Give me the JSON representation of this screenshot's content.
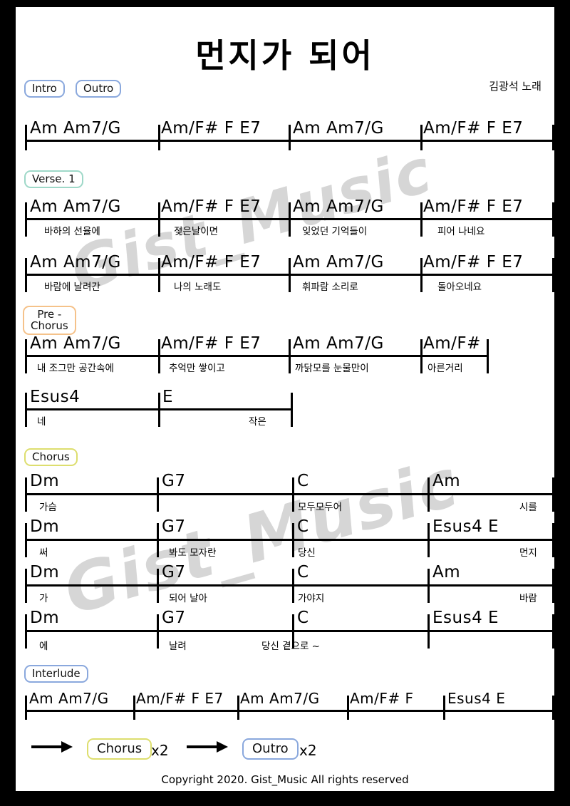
{
  "document": {
    "title": "먼지가 되어",
    "artist_credit": "김광석 노래",
    "copyright": "Copyright 2020. Gist_Music All rights reserved",
    "watermark": "Gist_Music"
  },
  "colors": {
    "page_background": "#ffffff",
    "frame": "#000000",
    "chip_blue": "#8aa8dd",
    "chip_teal": "#9ed8c8",
    "chip_orange": "#f5c28a",
    "chip_yellow": "#ddde6e",
    "watermark": "#d6d6d6",
    "ink": "#000000"
  },
  "sections": [
    {
      "id": "intro-outro",
      "labels": [
        "Intro",
        "Outro"
      ],
      "color": "blue",
      "rows": [
        {
          "bars": [
            {
              "chords": "Am      Am7/G"
            },
            {
              "chords": "Am/F#  F  E7"
            },
            {
              "chords": "Am      Am7/G"
            },
            {
              "chords": "Am/F#  F  E7"
            }
          ]
        }
      ]
    },
    {
      "id": "verse-1",
      "labels": [
        "Verse. 1"
      ],
      "color": "teal",
      "rows": [
        {
          "bars": [
            {
              "chords": "Am      Am7/G",
              "lyric": "바하의 선율에"
            },
            {
              "chords": "Am/F#  F  E7",
              "lyric": "젖은날이면"
            },
            {
              "chords": "Am      Am7/G",
              "lyric": "잊었던 기억들이"
            },
            {
              "chords": "Am/F#  F  E7",
              "lyric": "피어 나네요"
            }
          ]
        },
        {
          "bars": [
            {
              "chords": "Am      Am7/G",
              "lyric": "바람에 날려간"
            },
            {
              "chords": "Am/F#  F  E7",
              "lyric": "나의 노래도"
            },
            {
              "chords": "Am      Am7/G",
              "lyric": "휘파람 소리로"
            },
            {
              "chords": "Am/F#  F  E7",
              "lyric": "돌아오네요"
            }
          ]
        }
      ]
    },
    {
      "id": "pre-chorus",
      "labels": [
        "Pre -\nChorus"
      ],
      "color": "orange",
      "rows": [
        {
          "bars": [
            {
              "chords": "Am      Am7/G",
              "lyric": "내 조그만 공간속에"
            },
            {
              "chords": "Am/F#  F  E7",
              "lyric": "추억만 쌓이고"
            },
            {
              "chords": "Am      Am7/G",
              "lyric": "까닭모를 눈물만이"
            },
            {
              "chords": "Am/F#",
              "lyric": "아른거리"
            }
          ]
        },
        {
          "bars": [
            {
              "chords": "Esus4",
              "lyric": "네"
            },
            {
              "chords": "E",
              "lyric": "작은"
            }
          ]
        }
      ]
    },
    {
      "id": "chorus",
      "labels": [
        "Chorus"
      ],
      "color": "yellow",
      "rows": [
        {
          "bars": [
            {
              "chords": "Dm",
              "lyric": "가슴"
            },
            {
              "chords": "G7",
              "lyric": ""
            },
            {
              "chords": "C",
              "lyric": "모두모두어"
            },
            {
              "chords": "Am",
              "lyric": "시를"
            }
          ]
        },
        {
          "bars": [
            {
              "chords": "Dm",
              "lyric": "써"
            },
            {
              "chords": "G7",
              "lyric": "봐도            모자란"
            },
            {
              "chords": "C",
              "lyric": "당신"
            },
            {
              "chords": "Esus4  E",
              "lyric": "먼지"
            }
          ]
        },
        {
          "bars": [
            {
              "chords": "Dm",
              "lyric": "가"
            },
            {
              "chords": "G7",
              "lyric": "되어              날아"
            },
            {
              "chords": "C",
              "lyric": "가야지"
            },
            {
              "chords": "Am",
              "lyric": "바람"
            }
          ]
        },
        {
          "bars": [
            {
              "chords": "Dm",
              "lyric": "에"
            },
            {
              "chords": "G7",
              "lyric": "날려"
            },
            {
              "chords": "C",
              "lyric": "당신  곁으로 ~"
            },
            {
              "chords": "Esus4  E",
              "lyric": ""
            }
          ]
        }
      ]
    },
    {
      "id": "interlude",
      "labels": [
        "Interlude"
      ],
      "color": "blue",
      "rows": [
        {
          "bars": [
            {
              "chords": "Am     Am7/G"
            },
            {
              "chords": "Am/F#  F  E7"
            },
            {
              "chords": "Am      Am7/G"
            },
            {
              "chords": "Am/F#  F"
            },
            {
              "chords": "Esus4   E"
            }
          ]
        }
      ]
    }
  ],
  "repeat_line": {
    "items": [
      {
        "label": "Chorus",
        "color": "yellow",
        "times": "x2"
      },
      {
        "label": "Outro",
        "color": "blue",
        "times": "x2"
      }
    ]
  }
}
